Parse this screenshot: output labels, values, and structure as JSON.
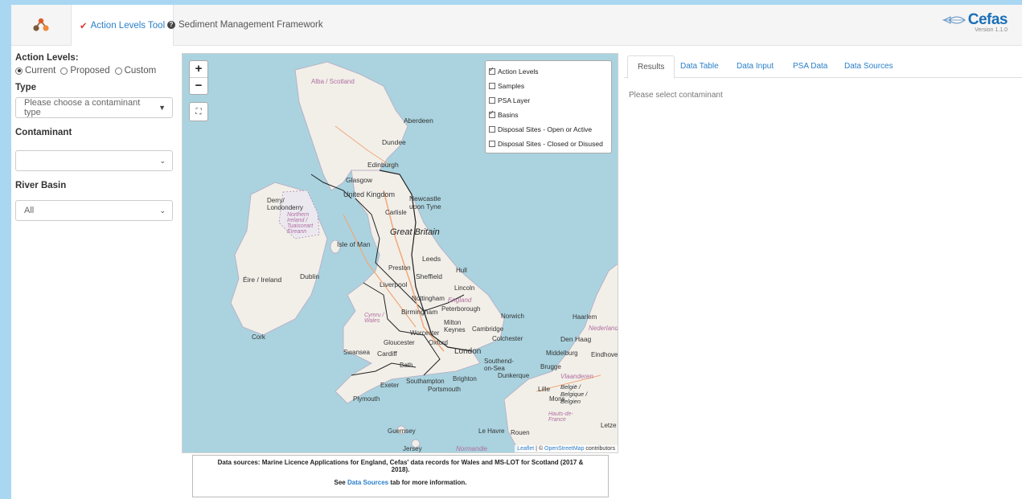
{
  "topnav": {
    "tabs": [
      {
        "label": "Action Levels Tool",
        "icon": "check-icon"
      },
      {
        "label": "Sediment Management Framework",
        "icon": "question-circle-icon"
      }
    ],
    "brand": {
      "name": "Cefas",
      "version": "Version 1.1.0"
    }
  },
  "left": {
    "action_levels_label": "Action Levels:",
    "radios": [
      "Current",
      "Proposed",
      "Custom"
    ],
    "selected_radio": "Current",
    "type_label": "Type",
    "type_placeholder": "Please choose a contaminant type",
    "contaminant_label": "Contaminant",
    "contaminant_value": "",
    "river_basin_label": "River Basin",
    "river_basin_value": "All"
  },
  "map": {
    "zoom_in": "+",
    "zoom_out": "−",
    "layers": [
      {
        "label": "Action Levels",
        "checked": true
      },
      {
        "label": "Samples",
        "checked": false
      },
      {
        "label": "PSA Layer",
        "checked": false
      },
      {
        "label": "Basins",
        "checked": true
      },
      {
        "label": "Disposal Sites - Open or Active",
        "checked": false
      },
      {
        "label": "Disposal Sites - Closed or Disused",
        "checked": false
      }
    ],
    "attribution": {
      "leaflet": "Leaflet",
      "sep": " | © ",
      "osm": "OpenStreetMap",
      "suffix": " contributors"
    },
    "labels": {
      "alba": "Alba / Scotland",
      "aberdeen": "Aberdeen",
      "dundee": "Dundee",
      "edinburgh": "Edinburgh",
      "glasgow": "Glasgow",
      "uk": "United Kingdom",
      "newcastle": "Newcastle upon Tyne",
      "carlisle": "Carlisle",
      "derry": "Derry/ Londonderry",
      "ni": "Northern Ireland / Tuaisceart Éireann",
      "gb": "Great Britain",
      "iom": "Isle of Man",
      "leeds": "Leeds",
      "hull": "Hull",
      "preston": "Preston",
      "sheffield": "Sheffield",
      "liverpool": "Liverpool",
      "eire": "Éire / Ireland",
      "dublin": "Dublin",
      "lincoln": "Lincoln",
      "nottingham": "Nottingham",
      "england": "England",
      "birmingham": "Birmingham",
      "peterborough": "Peterborough",
      "norwich": "Norwich",
      "cymru": "Cymru / Wales",
      "milton": "Milton Keynes",
      "cambridge": "Cambridge",
      "colchester": "Colchester",
      "cork": "Cork",
      "worcester": "Worcester",
      "gloucester": "Gloucester",
      "oxford": "Oxford",
      "london": "London",
      "swansea": "Swansea",
      "cardiff": "Cardiff",
      "bath": "Bath",
      "southend": "Southend-on-Sea",
      "exeter": "Exeter",
      "southampton": "Southampton",
      "brighton": "Brighton",
      "portsmouth": "Portsmouth",
      "plymouth": "Plymouth",
      "guernsey": "Guernsey",
      "jersey": "Jersey",
      "normandie": "Normandie",
      "lehavre": "Le Havre",
      "rouen": "Rouen",
      "dunkerque": "Dunkerque",
      "lille": "Lille",
      "mons": "Mons",
      "belgie": "België / Belgique / Belgien",
      "brugge": "Brugge",
      "vlaanderen": "Vlaanderen",
      "hauts": "Hauts-de-France",
      "middelburg": "Middelburg",
      "denhaag": "Den Haag",
      "haarlem": "Haarlem",
      "nederland": "Nederland",
      "eindhoven": "Eindhoven",
      "letze": "Letze"
    }
  },
  "data_sources": {
    "main": "Data sources: Marine Licence Applications for England, Cefas' data records for Wales and MS-LOT for Scotland (2017 & 2018).",
    "see": "See ",
    "link": "Data Sources",
    "after": " tab for more information."
  },
  "right": {
    "tabs": [
      "Results",
      "Data Table",
      "Data Input",
      "PSA Data",
      "Data Sources"
    ],
    "active_tab": "Results",
    "message": "Please select contaminant"
  },
  "colors": {
    "accent": "#2a7fc9",
    "sea": "#aad3df",
    "land": "#f2efe9",
    "background": "#a9d7f2"
  }
}
